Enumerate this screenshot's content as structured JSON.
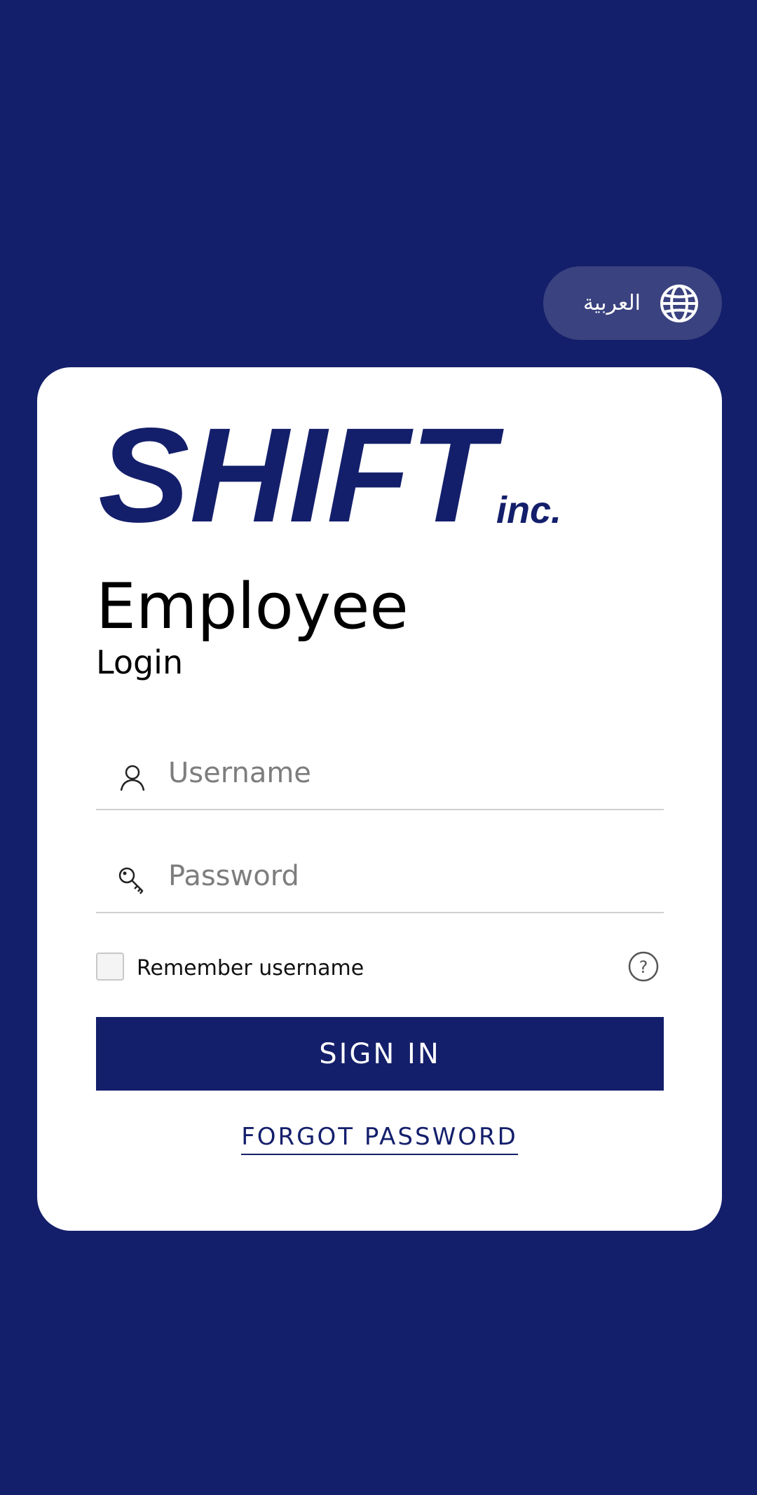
{
  "language_toggle": {
    "label": "العربية",
    "icon": "globe-icon"
  },
  "logo": {
    "text": "SHIFT",
    "suffix": "inc.",
    "color": "#141f6b"
  },
  "heading": {
    "title": "Employee",
    "subtitle": "Login"
  },
  "form": {
    "username": {
      "placeholder": "Username",
      "value": "",
      "icon": "user-icon"
    },
    "password": {
      "placeholder": "Password",
      "value": "",
      "icon": "key-icon"
    },
    "remember": {
      "label": "Remember username",
      "checked": false
    },
    "help_icon": "help-icon",
    "submit_label": "SIGN IN",
    "forgot_label": "FORGOT PASSWORD"
  },
  "colors": {
    "background": "#141f6b",
    "card": "#ffffff",
    "pill": "#3a427f",
    "accent": "#141f6b"
  }
}
